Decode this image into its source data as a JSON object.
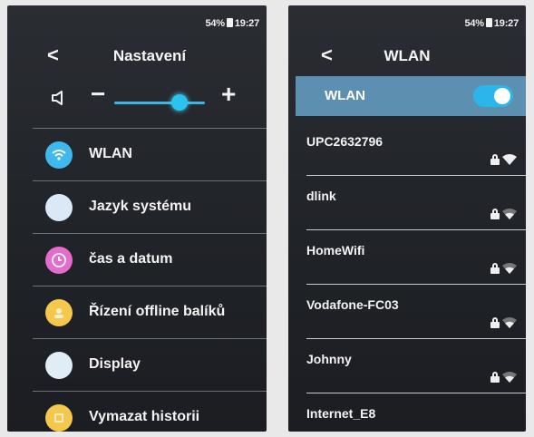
{
  "left": {
    "status": {
      "battery": "54%",
      "time": "19:27"
    },
    "title": "Nastavení",
    "volume": {
      "minus": "−",
      "plus": "+",
      "level": 0.72
    },
    "menu": [
      {
        "label": "WLAN",
        "icon": "wifi-icon",
        "color": "#3fb8ee"
      },
      {
        "label": "Jazyk systému",
        "icon": "globe-icon",
        "color": "#dbe9f6"
      },
      {
        "label": "čas a datum",
        "icon": "clock-icon",
        "color": "#e56bcc"
      },
      {
        "label": "Řízení offline balíků",
        "icon": "package-icon",
        "color": "#f3c84c"
      },
      {
        "label": "Display",
        "icon": "display-icon",
        "color": "#e0ecf6"
      },
      {
        "label": "Vymazat historii",
        "icon": "history-icon",
        "color": "#f3c84c"
      }
    ]
  },
  "right": {
    "status": {
      "battery": "54%",
      "time": "19:27"
    },
    "title": "WLAN",
    "wlan_toggle": {
      "label": "WLAN",
      "enabled": true
    },
    "networks": [
      {
        "name": "UPC2632796"
      },
      {
        "name": "dlink"
      },
      {
        "name": "HomeWifi"
      },
      {
        "name": "Vodafone-FC03"
      },
      {
        "name": "Johnny"
      },
      {
        "name": "Internet_E8"
      }
    ]
  },
  "colors": {
    "accent": "#2ab6ea",
    "wlan_bar": "#5d8fb0",
    "background": "#23262b"
  }
}
